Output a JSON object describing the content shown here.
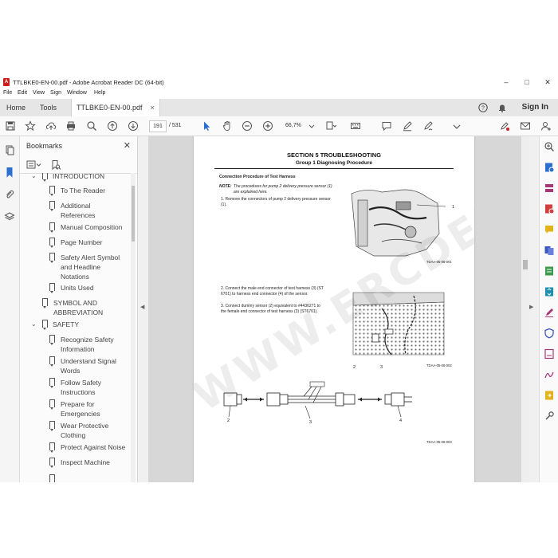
{
  "window": {
    "title": "TTLBKE0-EN-00.pdf - Adobe Acrobat Reader DC (64-bit)",
    "controls": {
      "minimize": "–",
      "maximize": "□",
      "close": "✕"
    }
  },
  "menu": [
    "File",
    "Edit",
    "View",
    "Sign",
    "Window",
    "Help"
  ],
  "tabs": {
    "home": "Home",
    "tools": "Tools",
    "document": "TTLBKE0-EN-00.pdf",
    "close": "×"
  },
  "header": {
    "sign_in": "Sign In"
  },
  "toolbar": {
    "page_current": "191",
    "page_total": "/ 531",
    "zoom": "66,7%"
  },
  "bookmarks": {
    "title": "Bookmarks",
    "close": "✕",
    "items": [
      {
        "label": "INTRODUCTION",
        "level": 0,
        "expanded": true
      },
      {
        "label": "To The Reader",
        "level": 1
      },
      {
        "label": "Additional References",
        "level": 1
      },
      {
        "label": "Manual Composition",
        "level": 1
      },
      {
        "label": "Page Number",
        "level": 1
      },
      {
        "label": "Safety Alert Symbol and Headline Notations",
        "level": 1
      },
      {
        "label": "Units Used",
        "level": 1
      },
      {
        "label": "SYMBOL AND ABBREVIATION",
        "level": 0
      },
      {
        "label": "SAFETY",
        "level": 0,
        "expanded": true
      },
      {
        "label": "Recognize Safety Information",
        "level": 1
      },
      {
        "label": "Understand Signal Words",
        "level": 1
      },
      {
        "label": "Follow Safety Instructions",
        "level": 1
      },
      {
        "label": "Prepare for Emergencies",
        "level": 1
      },
      {
        "label": "Wear Protective Clothing",
        "level": 1
      },
      {
        "label": "Protect Against Noise",
        "level": 1
      },
      {
        "label": "Inspect Machine",
        "level": 1
      }
    ]
  },
  "document": {
    "section_title": "SECTION 5 TROUBLESHOOTING",
    "group_title": "Group 1 Diagnosing Procedure",
    "heading": "Connection Procedure of Test Harness",
    "note_label": "NOTE:",
    "note_text": "The procedures for pump 2 delivery pressure sensor (1) are explained here.",
    "steps": [
      "1.  Remove the connectors of pump 2 delivery pressure sensor (1).",
      "2.  Connect the male end connector of test harness (3) (ST 6701) to harness end connector (4) of the sensor.",
      "3.  Connect dummy sensor (2) equivalent to #4436271 to the female end connector of test harness (3) (ST6701)."
    ],
    "figure_ids": [
      "TDAA-05-06-001",
      "TDAA-05-06-002",
      "TDAA-05-06-003"
    ],
    "callouts": {
      "fig1": [
        "1"
      ],
      "fig2": [
        "2",
        "3"
      ],
      "fig3": [
        "2",
        "3",
        "4"
      ]
    },
    "watermark": "WWW.ERCDEPO.COM"
  },
  "colors": {
    "acrobat_red": "#c8201d",
    "accent_blue": "#2c6fd1",
    "panel_bg": "#fbfbfb",
    "doc_bg": "#d7d7d7"
  },
  "icons": {
    "rail": [
      "page-thumbnails-icon",
      "bookmarks-icon",
      "attachments-icon",
      "layers-icon"
    ],
    "right_tools": [
      "zoom-icon",
      "export-pdf-icon",
      "organize-pages-icon",
      "create-pdf-icon",
      "comment-icon",
      "combine-files-icon",
      "edit-pdf-icon",
      "compress-pdf-icon",
      "fill-sign-icon",
      "protect-icon",
      "request-signature-icon",
      "sign-icon",
      "send-comments-icon",
      "more-tools-icon"
    ]
  }
}
